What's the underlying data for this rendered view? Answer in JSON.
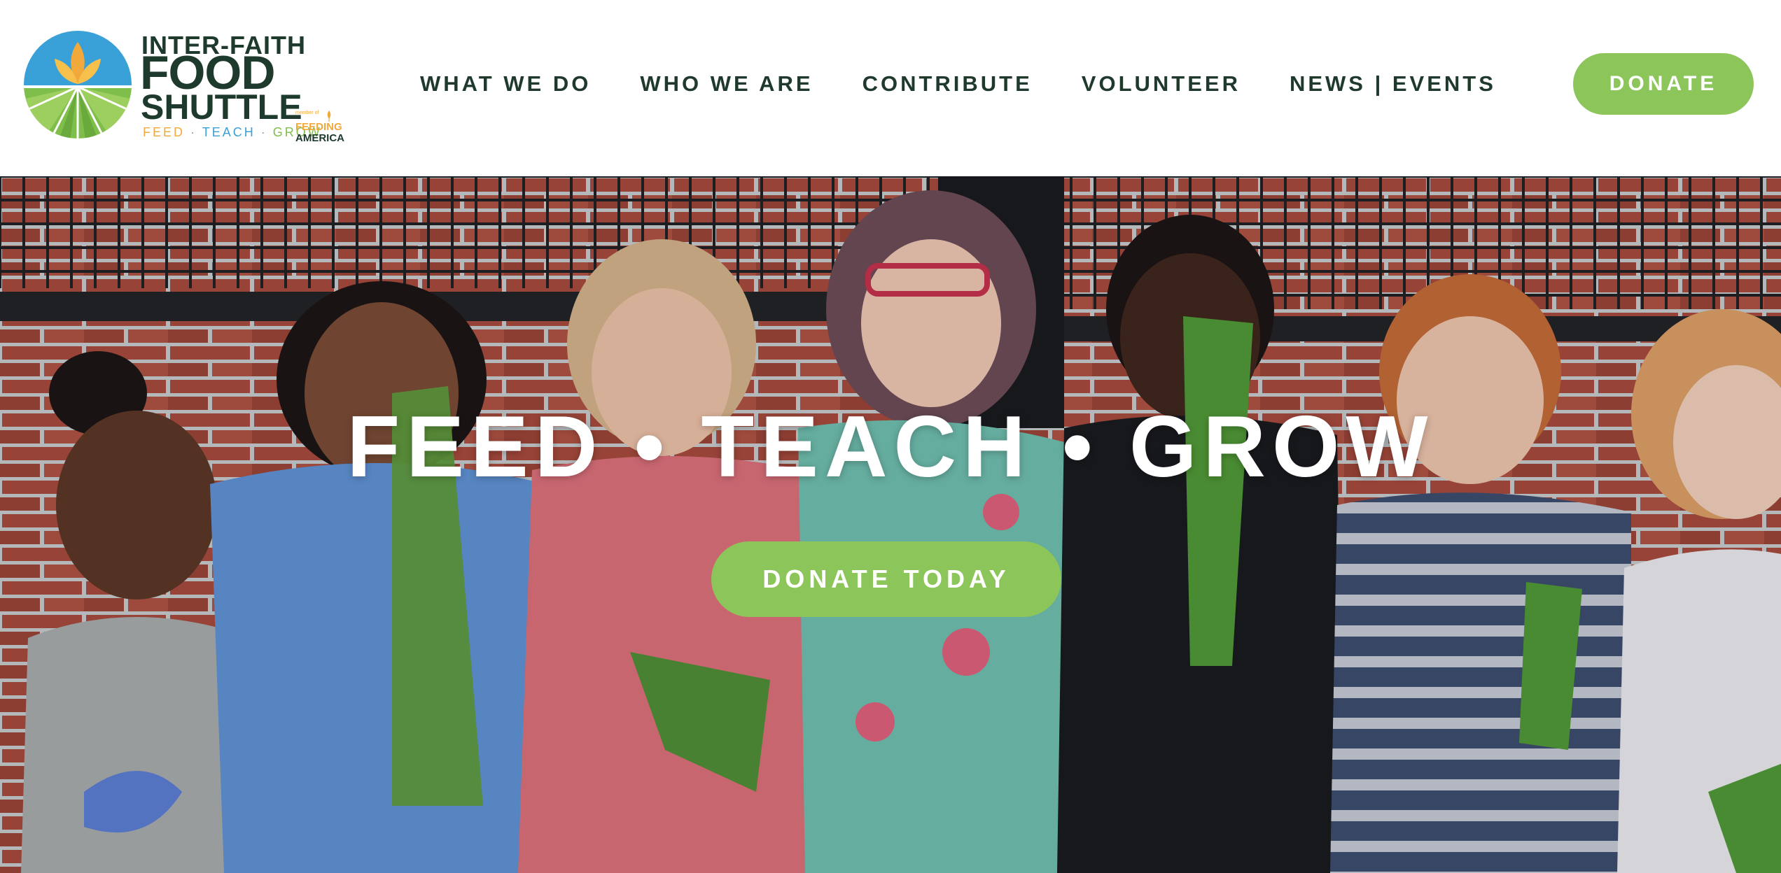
{
  "header": {
    "logo": {
      "line1": "INTER-FAITH",
      "line2": "FOOD",
      "line3": "SHUTTLE",
      "tagline": {
        "feed": "FEED",
        "teach": "TEACH",
        "grow": "GROW",
        "separator": "·"
      },
      "partner": {
        "small": "member of",
        "line1": "FEEDING",
        "line2": "AMERICA"
      }
    },
    "nav": {
      "items": [
        {
          "label": "WHAT WE DO"
        },
        {
          "label": "WHO WE ARE"
        },
        {
          "label": "CONTRIBUTE"
        },
        {
          "label": "VOLUNTEER"
        },
        {
          "label": "NEWS | EVENTS"
        }
      ]
    },
    "donate_label": "DONATE"
  },
  "hero": {
    "title": "FEED • TEACH • GROW",
    "cta_label": "DONATE TODAY"
  },
  "colors": {
    "brand_dark": "#1e3a2c",
    "accent_green": "#8cc65a",
    "logo_blue": "#3aa0d8",
    "logo_orange": "#f2a93b"
  }
}
